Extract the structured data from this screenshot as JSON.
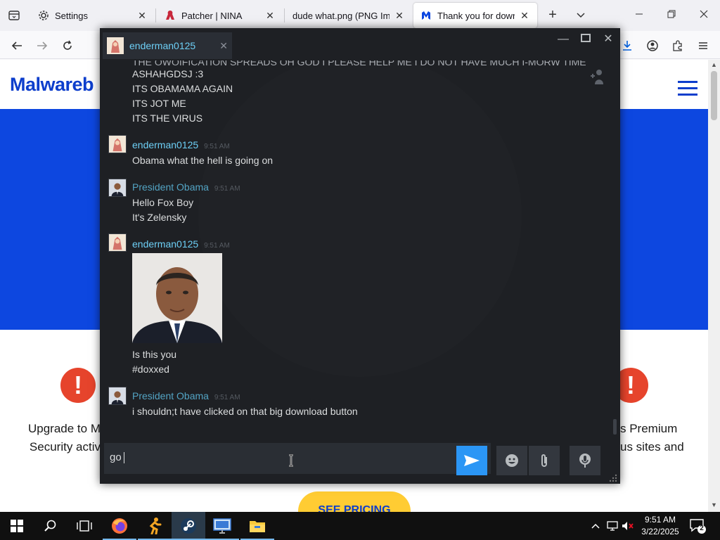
{
  "browser": {
    "tabs": [
      {
        "title": "Settings"
      },
      {
        "title": "Patcher | NINA"
      },
      {
        "title": "dude what.png (PNG Imag"
      },
      {
        "title": "Thank you for downloa",
        "active": true
      }
    ],
    "colors": {
      "accent": "#0060df"
    }
  },
  "page": {
    "logo_text": "Malwareb",
    "feature_left": [
      "Upgrade to M",
      "Security activ"
    ],
    "feature_right": [
      "s Premium",
      "us sites and"
    ],
    "pricing_button": "SEE PRICING",
    "colors": {
      "brand_blue": "#0d47e0",
      "warning_red": "#e6442c",
      "button_yellow": "#ffcc33"
    }
  },
  "chat": {
    "tab_name": "enderman0125",
    "partial_top_line": "THE OWOIFICATION SPREADS OH GOD I PLEASE HELP ME I DO NOT HAVE MUCH I-MORW TIME",
    "messages": [
      {
        "lines": [
          "ASHAHGDSJ :3",
          "ITS OBAMAMA AGAIN",
          "ITS JOT ME",
          "ITS THE VIRUS"
        ]
      },
      {
        "sender": "enderman0125",
        "time": "9:51 AM",
        "lines": [
          "Obama what the hell is going on"
        ]
      },
      {
        "sender": "President Obama",
        "time": "9:51 AM",
        "lines": [
          "Hello Fox Boy",
          "It's Zelensky"
        ]
      },
      {
        "sender": "enderman0125",
        "time": "9:51 AM",
        "has_image": true,
        "lines": [
          "Is this you",
          "#doxxed"
        ]
      },
      {
        "sender": "President Obama",
        "time": "9:51 AM",
        "lines": [
          "i shouldn;t have clicked on that big download button"
        ]
      }
    ],
    "input_value": "go",
    "colors": {
      "self_name": "#6dcff6",
      "friend_name": "#53a4c4",
      "send": "#2b96f5"
    }
  },
  "taskbar": {
    "clock_time": "9:51 AM",
    "clock_date": "3/22/2025",
    "notification_count": "2",
    "icons": [
      "windows-start-icon",
      "search-icon",
      "task-view-icon",
      "firefox-icon",
      "runner-app-icon",
      "steam-icon",
      "remote-desktop-icon",
      "file-explorer-icon"
    ]
  }
}
